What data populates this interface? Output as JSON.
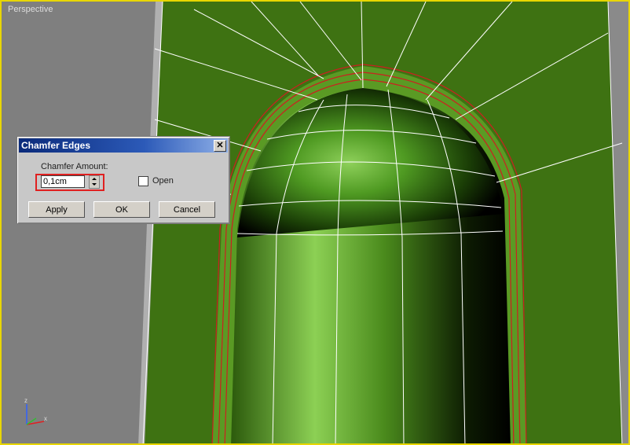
{
  "viewport": {
    "label": "Perspective",
    "axis_labels": {
      "z": "z",
      "x": "x"
    },
    "colors": {
      "border": "#e8d600",
      "surface": "#3e7212",
      "edge": "#ffffff",
      "selected_edge": "#cc2020"
    }
  },
  "dialog": {
    "title": "Chamfer Edges",
    "close_label": "✕",
    "amount_label": "Chamfer Amount:",
    "amount_value": "0,1cm",
    "open_label": "Open",
    "open_checked": false,
    "buttons": {
      "apply": "Apply",
      "ok": "OK",
      "cancel": "Cancel"
    }
  }
}
